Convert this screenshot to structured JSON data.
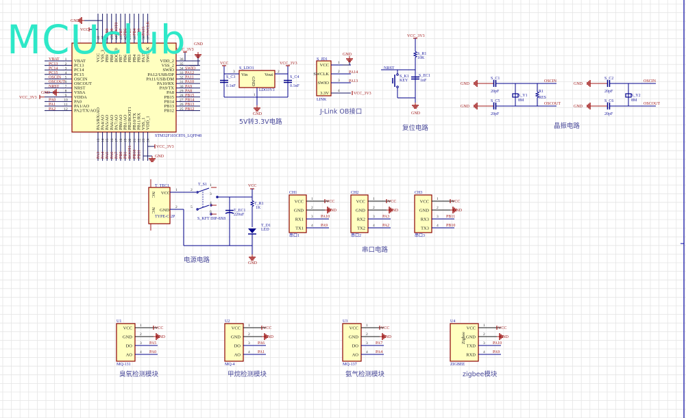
{
  "watermark": "MCUclub",
  "colors": {
    "wire": "#00008b",
    "net": "#a01818",
    "body_fill": "#ffffc0",
    "body_stroke": "#8b0000",
    "grid": "#e4e4e4",
    "title": "#4a4a9a",
    "watermark": "#2ee8c8"
  },
  "mcu": {
    "ref": "U1",
    "part": "STM32F103C8T6_LQFP48",
    "left_pins": [
      {
        "num": "1",
        "name": "VBAT",
        "net": "VBAT"
      },
      {
        "num": "2",
        "name": "PC13",
        "net": "PC13"
      },
      {
        "num": "3",
        "name": "PC14",
        "net": "PC14"
      },
      {
        "num": "4",
        "name": "PC15",
        "net": "PC15"
      },
      {
        "num": "5",
        "name": "OSCIN",
        "net": "OSCIN"
      },
      {
        "num": "6",
        "name": "OSCOUT",
        "net": "OSCOUT"
      },
      {
        "num": "7",
        "name": "NRST",
        "net": "NRST"
      },
      {
        "num": "8",
        "name": "VSSA",
        "net": "GND"
      },
      {
        "num": "9",
        "name": "VDDA",
        "net": "VCC_3V3"
      },
      {
        "num": "10",
        "name": "PA0",
        "net": "PA0"
      },
      {
        "num": "11",
        "name": "PA1/AO",
        "net": "PA1"
      },
      {
        "num": "12",
        "name": "PA2/TX/AO",
        "net": "PA2"
      }
    ],
    "right_pins": [
      {
        "num": "36",
        "name": "VDD_2",
        "net": "VCC_3V3"
      },
      {
        "num": "35",
        "name": "VSS_2",
        "net": "GND"
      },
      {
        "num": "34",
        "name": "SWIO",
        "net": "SWIO"
      },
      {
        "num": "33",
        "name": "PA12/USB/DP",
        "net": "PA12"
      },
      {
        "num": "32",
        "name": "PA11/USB/DM",
        "net": "PA11"
      },
      {
        "num": "31",
        "name": "PA10/RX",
        "net": "PA10"
      },
      {
        "num": "30",
        "name": "PA9/TX",
        "net": "PA9"
      },
      {
        "num": "29",
        "name": "PA8",
        "net": "PA8"
      },
      {
        "num": "28",
        "name": "PB15",
        "net": "PB15"
      },
      {
        "num": "27",
        "name": "PB14",
        "net": "PB14"
      },
      {
        "num": "26",
        "name": "PB13",
        "net": "PB13"
      },
      {
        "num": "25",
        "name": "PB12",
        "net": "PB12"
      }
    ],
    "top_pins": [
      {
        "num": "48",
        "name": "VCC",
        "net": "VCC"
      },
      {
        "num": "47",
        "name": "VSS_3",
        "net": "GND"
      },
      {
        "num": "46",
        "name": "PB9",
        "net": "PB9"
      },
      {
        "num": "45",
        "name": "PB8",
        "net": "PB8"
      },
      {
        "num": "44",
        "name": "BOOT0",
        "net": "BOOT0"
      },
      {
        "num": "43",
        "name": "PB7",
        "net": "PB7"
      },
      {
        "num": "42",
        "name": "PB6",
        "net": "PB6"
      },
      {
        "num": "41",
        "name": "PB5",
        "net": "PB5"
      },
      {
        "num": "40",
        "name": "PB4",
        "net": "PB4"
      },
      {
        "num": "39",
        "name": "PB3",
        "net": "PB3"
      },
      {
        "num": "38",
        "name": "PA15",
        "net": "PA15"
      },
      {
        "num": "37",
        "name": "SWCLK",
        "net": "SWCLK"
      }
    ],
    "bottom_pins": [
      {
        "num": "13",
        "name": "PA3/RX/AO",
        "net": "PA3"
      },
      {
        "num": "14",
        "name": "PA4/AO",
        "net": "PA4"
      },
      {
        "num": "15",
        "name": "PA5/AO",
        "net": "PA5"
      },
      {
        "num": "16",
        "name": "PA6/AO",
        "net": "PA6"
      },
      {
        "num": "17",
        "name": "PA7/AO",
        "net": "PA7"
      },
      {
        "num": "18",
        "name": "PB0/AO",
        "net": "PB0"
      },
      {
        "num": "19",
        "name": "PB1/AO",
        "net": "PB1"
      },
      {
        "num": "20",
        "name": "PB2/BOOT1",
        "net": "BOOT1"
      },
      {
        "num": "21",
        "name": "PB10/TX",
        "net": "PB10"
      },
      {
        "num": "22",
        "name": "PB11/RX",
        "net": "PB11"
      },
      {
        "num": "23",
        "name": "VSS_1",
        "net": "GND"
      },
      {
        "num": "24",
        "name": "VDD_1",
        "net": "VCC_3V3"
      }
    ]
  },
  "ldo": {
    "title": "5V转3.3V电路",
    "ref": "S_LDO1",
    "part": "LDO3V3",
    "vin": "Vin",
    "vout": "Vout",
    "gnd_pin": "GND",
    "pin_in": "3",
    "pin_out": "2",
    "pin_gnd": "1",
    "vcc_in": "VCC",
    "vcc_out": "VCC_3V3",
    "gnd": "GND",
    "c_in": {
      "ref": "S_C3",
      "value": "0.1nF"
    },
    "c_out": {
      "ref": "S_C4",
      "value": "0.1nF"
    }
  },
  "jlink": {
    "title": "J-Link OB接口",
    "ref": "S_JD1",
    "part": "LINK",
    "pins": [
      {
        "num": "1",
        "name": "VCC",
        "net": "GND"
      },
      {
        "num": "2",
        "name": "SWCLK",
        "net": "PA14"
      },
      {
        "num": "3",
        "name": "SWIO",
        "net": "PA13"
      },
      {
        "num": "4",
        "name": "3.3V",
        "net": "VCC_3V3"
      }
    ]
  },
  "reset": {
    "title": "复位电路",
    "vcc": "VCC_3V3",
    "net": "NRST",
    "gnd": "GND",
    "resistor": {
      "ref": "S_R1",
      "value": "10K"
    },
    "key": {
      "ref": "S_K1",
      "value": "KEY"
    },
    "cap": {
      "ref": "S_EC1",
      "value": "1nF"
    }
  },
  "crystal": {
    "title": "晶振电路",
    "left": {
      "c_top": {
        "ref": "S_C1",
        "value": "20pF"
      },
      "c_bot": {
        "ref": "S_C5",
        "value": "20pF"
      },
      "xtal": {
        "ref": "S_Y1",
        "value": "8M"
      },
      "res": {
        "ref": "R1",
        "value": "RES"
      }
    },
    "right": {
      "c_top": {
        "ref": "S_C2",
        "value": "20pF"
      },
      "c_bot": {
        "ref": "S_C6",
        "value": "20pF"
      },
      "xtal": {
        "ref": "S_Y2",
        "value": "8M"
      }
    },
    "gnd": "GND",
    "oscin": "OSCIN",
    "oscout": "OSCOUT"
  },
  "power": {
    "title": "电源电路",
    "connector": {
      "ref": "T_TEC1",
      "part": "TYPE-C-2P",
      "vcc": "VCC",
      "gnd": "GND",
      "nc": "NC",
      "pin1": "1",
      "pin2": "2"
    },
    "switch": {
      "ref": "T_S1",
      "part": "S_KFT DIP-8X8",
      "pins": [
        "1",
        "2",
        "3",
        "4",
        "5",
        "6"
      ]
    },
    "cap": {
      "ref": "T_EC1",
      "value": "220uF"
    },
    "resistor": {
      "ref": "T_R1",
      "value": "1K"
    },
    "led": {
      "ref": "T_D1",
      "value": "LED"
    },
    "vcc": "VCC",
    "gnd": "GND"
  },
  "serial": {
    "title": "串口电路",
    "modules": [
      {
        "ref": "CH1",
        "footer": "串口1",
        "pins": [
          {
            "num": "1",
            "name": "VCC",
            "net": "VCC"
          },
          {
            "num": "2",
            "name": "GND",
            "net": "GND"
          },
          {
            "num": "3",
            "name": "RX1",
            "net": "PA10"
          },
          {
            "num": "4",
            "name": "TX1",
            "net": "PA9"
          }
        ]
      },
      {
        "ref": "CH2",
        "footer": "串口2",
        "pins": [
          {
            "num": "1",
            "name": "VCC",
            "net": "VCC"
          },
          {
            "num": "2",
            "name": "GND",
            "net": "GND"
          },
          {
            "num": "3",
            "name": "RX2",
            "net": "PA3"
          },
          {
            "num": "4",
            "name": "TX2",
            "net": "PA2"
          }
        ]
      },
      {
        "ref": "CH3",
        "footer": "串口3",
        "pins": [
          {
            "num": "1",
            "name": "VCC",
            "net": "VCC"
          },
          {
            "num": "2",
            "name": "GND",
            "net": "GND"
          },
          {
            "num": "3",
            "name": "RX3",
            "net": "PB11"
          },
          {
            "num": "4",
            "name": "TX3",
            "net": "PB10"
          }
        ]
      }
    ]
  },
  "sensors": [
    {
      "ref": "U1",
      "footer": "MQ-131",
      "title": "臭氧检测模块",
      "inner": "",
      "pins": [
        {
          "num": "1",
          "name": "VCC",
          "net": "VCC"
        },
        {
          "num": "2",
          "name": "GND",
          "net": "GND"
        },
        {
          "num": "3",
          "name": "DO",
          "net": "PA5"
        },
        {
          "num": "4",
          "name": "AO",
          "net": "PA0"
        }
      ]
    },
    {
      "ref": "U2",
      "footer": "MQ-4",
      "title": "甲烷检测模块",
      "inner": "",
      "pins": [
        {
          "num": "1",
          "name": "VCC",
          "net": "VCC"
        },
        {
          "num": "2",
          "name": "GND",
          "net": "GND"
        },
        {
          "num": "3",
          "name": "DO",
          "net": "PA6"
        },
        {
          "num": "4",
          "name": "AO",
          "net": "PA1"
        }
      ]
    },
    {
      "ref": "U3",
      "footer": "MQ-137",
      "title": "氨气检测模块",
      "inner": "",
      "pins": [
        {
          "num": "1",
          "name": "VCC",
          "net": "VCC"
        },
        {
          "num": "2",
          "name": "GND",
          "net": "GND"
        },
        {
          "num": "3",
          "name": "DO",
          "net": "PA7"
        },
        {
          "num": "4",
          "name": "AO",
          "net": "PA4"
        }
      ]
    },
    {
      "ref": "U4",
      "footer": "ZIGBEE",
      "title": "zigbee模块",
      "inner": "Zigbee",
      "pins": [
        {
          "num": "1",
          "name": "VCC",
          "net": "VCC"
        },
        {
          "num": "2",
          "name": "GND",
          "net": "GND"
        },
        {
          "num": "3",
          "name": "TXD",
          "net": "PA10"
        },
        {
          "num": "4",
          "name": "RXD",
          "net": "PA9"
        }
      ]
    }
  ]
}
